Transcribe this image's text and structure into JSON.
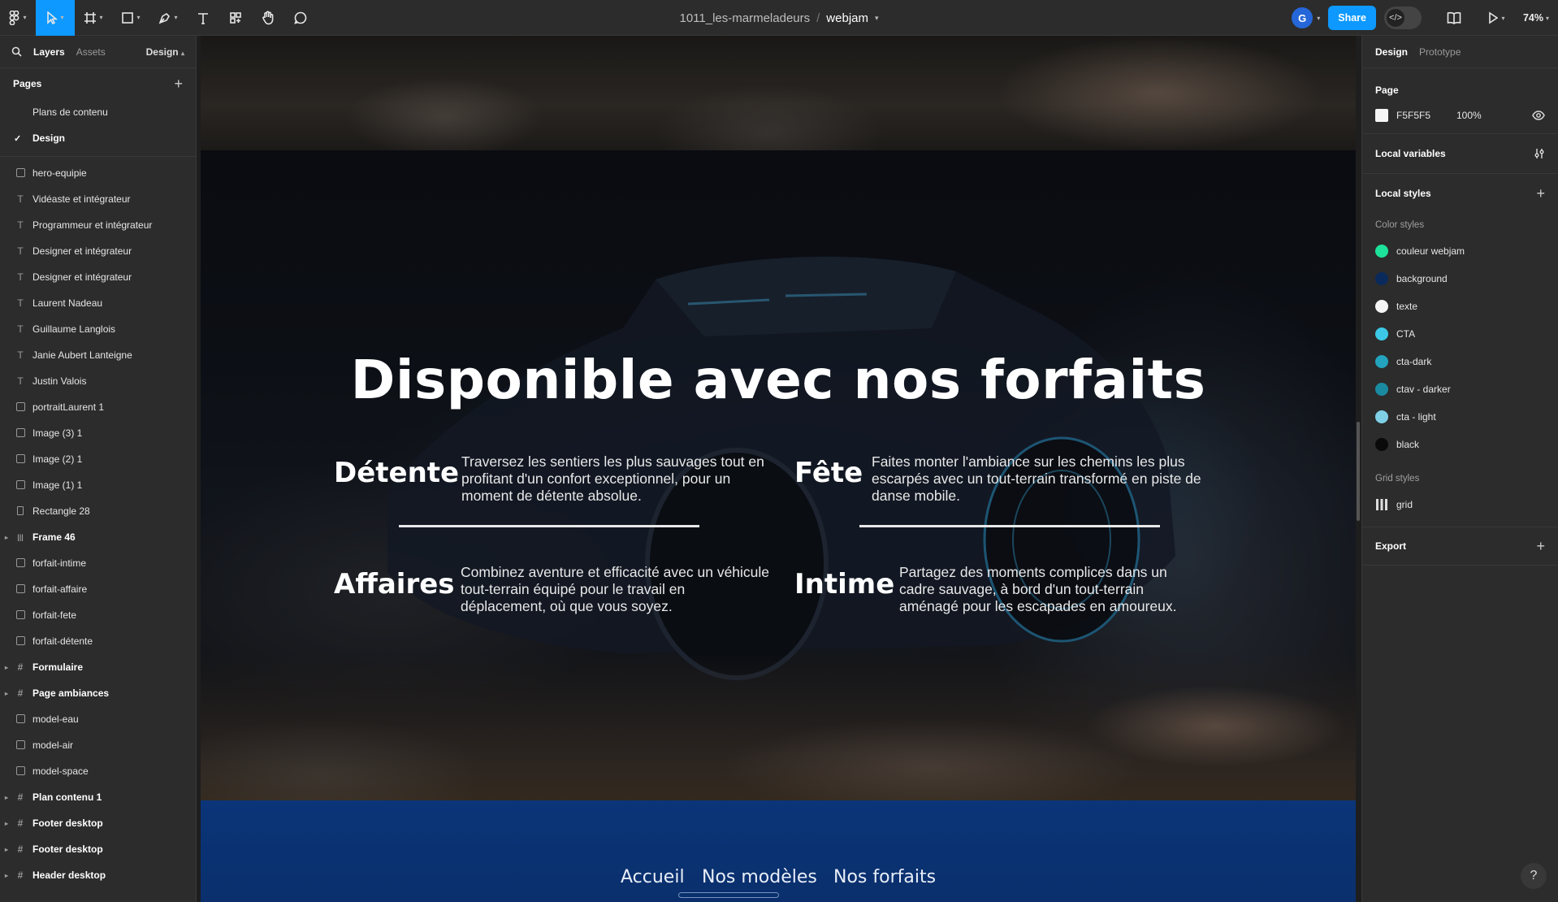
{
  "toolbar": {
    "file_project": "1011_les-marmeladeurs",
    "file_name": "webjam",
    "avatar_initial": "G",
    "share_label": "Share",
    "zoom": "74%"
  },
  "left_panel": {
    "tab_layers": "Layers",
    "tab_assets": "Assets",
    "design_dropdown": "Design",
    "pages_title": "Pages",
    "pages": [
      {
        "label": "Plans de contenu",
        "selected": false
      },
      {
        "label": "Design",
        "selected": true
      }
    ],
    "layers": [
      {
        "label": "hero-equipie",
        "icon": "image-icon",
        "bold": false,
        "expandable": false
      },
      {
        "label": "Vidéaste et intégrateur",
        "icon": "text-icon",
        "bold": false,
        "expandable": false
      },
      {
        "label": "Programmeur et intégrateur",
        "icon": "text-icon",
        "bold": false,
        "expandable": false
      },
      {
        "label": "Designer et intégrateur",
        "icon": "text-icon",
        "bold": false,
        "expandable": false
      },
      {
        "label": "Designer et intégrateur",
        "icon": "text-icon",
        "bold": false,
        "expandable": false
      },
      {
        "label": "Laurent Nadeau",
        "icon": "text-icon",
        "bold": false,
        "expandable": false
      },
      {
        "label": "Guillaume Langlois",
        "icon": "text-icon",
        "bold": false,
        "expandable": false
      },
      {
        "label": "Janie Aubert Lanteigne",
        "icon": "text-icon",
        "bold": false,
        "expandable": false
      },
      {
        "label": "Justin Valois",
        "icon": "text-icon",
        "bold": false,
        "expandable": false
      },
      {
        "label": "portraitLaurent 1",
        "icon": "image-icon",
        "bold": false,
        "expandable": false
      },
      {
        "label": "Image (3) 1",
        "icon": "image-icon",
        "bold": false,
        "expandable": false
      },
      {
        "label": "Image (2) 1",
        "icon": "image-icon",
        "bold": false,
        "expandable": false
      },
      {
        "label": "Image (1) 1",
        "icon": "image-icon",
        "bold": false,
        "expandable": false
      },
      {
        "label": "Rectangle 28",
        "icon": "rectangle-icon",
        "bold": false,
        "expandable": false
      },
      {
        "label": "Frame 46",
        "icon": "columns-icon",
        "bold": true,
        "expandable": true
      },
      {
        "label": "forfait-intime",
        "icon": "image-icon",
        "bold": false,
        "expandable": false
      },
      {
        "label": "forfait-affaire",
        "icon": "image-icon",
        "bold": false,
        "expandable": false
      },
      {
        "label": "forfait-fete",
        "icon": "image-icon",
        "bold": false,
        "expandable": false
      },
      {
        "label": "forfait-détente",
        "icon": "image-icon",
        "bold": false,
        "expandable": false
      },
      {
        "label": "Formulaire",
        "icon": "frame-icon",
        "bold": true,
        "expandable": true
      },
      {
        "label": "Page ambiances",
        "icon": "frame-icon",
        "bold": true,
        "expandable": true
      },
      {
        "label": "model-eau",
        "icon": "image-icon",
        "bold": false,
        "expandable": false
      },
      {
        "label": "model-air",
        "icon": "image-icon",
        "bold": false,
        "expandable": false
      },
      {
        "label": "model-space",
        "icon": "image-icon",
        "bold": false,
        "expandable": false
      },
      {
        "label": "Plan contenu 1",
        "icon": "frame-icon",
        "bold": true,
        "expandable": true
      },
      {
        "label": "Footer desktop",
        "icon": "frame-icon",
        "bold": true,
        "expandable": true
      },
      {
        "label": "Footer desktop",
        "icon": "frame-icon",
        "bold": true,
        "expandable": true
      },
      {
        "label": "Header desktop",
        "icon": "frame-icon",
        "bold": true,
        "expandable": true
      }
    ]
  },
  "canvas": {
    "heading": "Disponible avec nos forfaits",
    "packages": [
      {
        "name": "Détente",
        "description": "Traversez les sentiers les plus sauvages tout en profitant d'un confort exceptionnel, pour un moment de détente absolue."
      },
      {
        "name": "Fête",
        "description": "Faites monter l'ambiance sur les chemins les plus escarpés avec un tout-terrain transformé en piste de danse mobile."
      },
      {
        "name": "Affaires",
        "description": "Combinez aventure et efficacité avec un véhicule tout-terrain équipé pour le travail en déplacement, où que vous soyez."
      },
      {
        "name": "Intime",
        "description": "Partagez des moments complices dans un cadre sauvage, à bord d'un tout-terrain aménagé pour les escapades en amoureux."
      }
    ],
    "nav": [
      "Accueil",
      "Nos modèles",
      "Nos forfaits"
    ]
  },
  "right_panel": {
    "tab_design": "Design",
    "tab_prototype": "Prototype",
    "page_title": "Page",
    "page_color": "F5F5F5",
    "page_color_hex": "#F5F5F5",
    "page_opacity": "100%",
    "local_variables": "Local variables",
    "local_styles": "Local styles",
    "color_styles_title": "Color styles",
    "color_styles": [
      {
        "name": "couleur webjam",
        "color": "#1de29a"
      },
      {
        "name": "background",
        "color": "#0b2a5c"
      },
      {
        "name": "texte",
        "color": "#f5f5f5"
      },
      {
        "name": "CTA",
        "color": "#3cc8e6"
      },
      {
        "name": "cta-dark",
        "color": "#23a3bd"
      },
      {
        "name": "ctav - darker",
        "color": "#1a8aa0"
      },
      {
        "name": "cta - light",
        "color": "#7fcfe6"
      },
      {
        "name": "black",
        "color": "#0a0a0a"
      }
    ],
    "grid_styles_title": "Grid styles",
    "grid_style": "grid",
    "export": "Export",
    "help": "?"
  }
}
